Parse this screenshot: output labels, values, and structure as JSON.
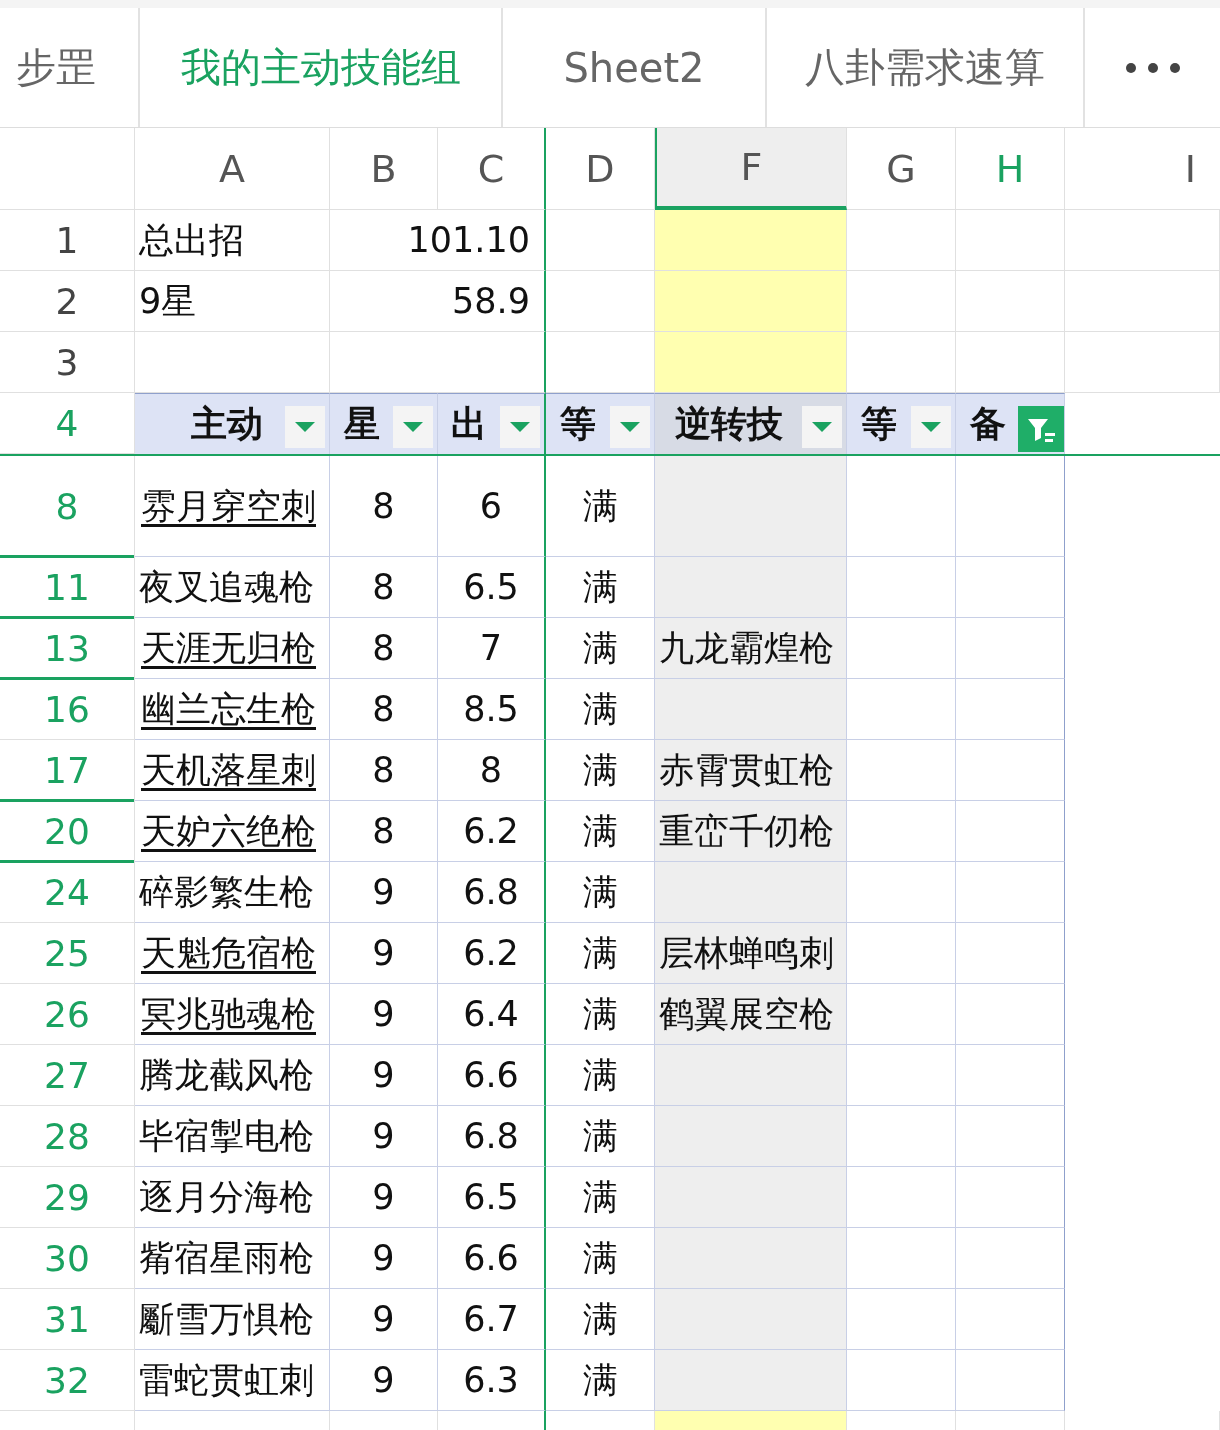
{
  "sheet_tabs": [
    {
      "label": "步罡",
      "selected": false
    },
    {
      "label": "我的主动技能组",
      "selected": true
    },
    {
      "label": "Sheet2",
      "selected": false
    },
    {
      "label": "八卦需求速算",
      "selected": false
    }
  ],
  "column_headers": [
    {
      "label": "A",
      "selected": false,
      "filtered": false
    },
    {
      "label": "B",
      "selected": false,
      "filtered": false
    },
    {
      "label": "C",
      "selected": false,
      "filtered": false
    },
    {
      "label": "D",
      "selected": false,
      "filtered": false
    },
    {
      "label": "F",
      "selected": true,
      "filtered": false
    },
    {
      "label": "G",
      "selected": false,
      "filtered": false
    },
    {
      "label": "H",
      "selected": false,
      "filtered": true
    },
    {
      "label": "I",
      "selected": false,
      "filtered": false
    }
  ],
  "top_rows": [
    {
      "row": "1",
      "label": "总出招",
      "value": "101.10"
    },
    {
      "row": "2",
      "label": "9星",
      "value": "58.9"
    },
    {
      "row": "3"
    }
  ],
  "table": {
    "row": "4",
    "headers": [
      {
        "label": "主动",
        "filter_active": false
      },
      {
        "label": "星",
        "filter_active": false
      },
      {
        "label": "出",
        "filter_active": false
      },
      {
        "label": "等",
        "filter_active": false
      },
      {
        "label": "逆转技",
        "filter_active": false
      },
      {
        "label": "等",
        "filter_active": false
      },
      {
        "label": "备",
        "filter_active": true
      }
    ],
    "rows": [
      {
        "row": "8",
        "name": "雰月穿空刺",
        "link": true,
        "star": "8",
        "rate": "6",
        "grade": "满",
        "gap_after": true
      },
      {
        "row": "11",
        "name": "夜叉追魂枪",
        "link": false,
        "star": "8",
        "rate": "6.5",
        "grade": "满",
        "gap_after": true
      },
      {
        "row": "13",
        "name": "天涯无归枪",
        "link": true,
        "star": "8",
        "rate": "7",
        "grade": "满",
        "reversal": "九龙霸煌枪",
        "gap_after": true
      },
      {
        "row": "16",
        "name": "幽兰忘生枪",
        "link": true,
        "star": "8",
        "rate": "8.5",
        "grade": "满",
        "gap_after": false
      },
      {
        "row": "17",
        "name": "天机落星刺",
        "link": true,
        "star": "8",
        "rate": "8",
        "grade": "满",
        "reversal": "赤霄贯虹枪",
        "gap_after": true
      },
      {
        "row": "20",
        "name": "天妒六绝枪",
        "link": true,
        "star": "8",
        "rate": "6.2",
        "grade": "满",
        "reversal": "重峦千仞枪",
        "gap_after": true
      },
      {
        "row": "24",
        "name": "碎影繁生枪",
        "link": false,
        "star": "9",
        "rate": "6.8",
        "grade": "满",
        "gap_after": false
      },
      {
        "row": "25",
        "name": "天魁危宿枪",
        "link": true,
        "star": "9",
        "rate": "6.2",
        "grade": "满",
        "reversal": "层林蝉鸣刺",
        "gap_after": false
      },
      {
        "row": "26",
        "name": "冥兆驰魂枪",
        "link": true,
        "star": "9",
        "rate": "6.4",
        "grade": "满",
        "reversal": "鹤翼展空枪",
        "gap_after": false
      },
      {
        "row": "27",
        "name": "腾龙截风枪",
        "link": false,
        "star": "9",
        "rate": "6.6",
        "grade": "满",
        "gap_after": false
      },
      {
        "row": "28",
        "name": "毕宿掣电枪",
        "link": false,
        "star": "9",
        "rate": "6.8",
        "grade": "满",
        "gap_after": false
      },
      {
        "row": "29",
        "name": "逐月分海枪",
        "link": false,
        "star": "9",
        "rate": "6.5",
        "grade": "满",
        "gap_after": false
      },
      {
        "row": "30",
        "name": "觜宿星雨枪",
        "link": false,
        "star": "9",
        "rate": "6.6",
        "grade": "满",
        "gap_after": false
      },
      {
        "row": "31",
        "name": "斸雪万惧枪",
        "link": false,
        "star": "9",
        "rate": "6.7",
        "grade": "满",
        "gap_after": false
      },
      {
        "row": "32",
        "name": "雷蛇贯虹刺",
        "link": false,
        "star": "9",
        "rate": "6.3",
        "grade": "满",
        "gap_after": false
      }
    ]
  }
}
